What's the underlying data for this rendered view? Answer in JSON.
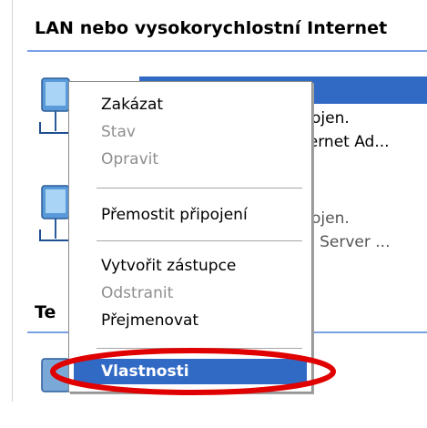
{
  "groups": {
    "lan_header": "LAN nebo vysokorychlostní Internet",
    "tel_header": "Te"
  },
  "connection1": {
    "line2": "ojen.",
    "line3": "hernet Ad..."
  },
  "connection2": {
    "line2": "ojen.",
    "line3": "ss Server ..."
  },
  "context_menu": {
    "items": [
      {
        "label": "Zakázat",
        "enabled": true
      },
      {
        "label": "Stav",
        "enabled": false
      },
      {
        "label": "Opravit",
        "enabled": false
      },
      {
        "label": "Přemostit připojení",
        "enabled": true
      },
      {
        "label": "Vytvořit zástupce",
        "enabled": true
      },
      {
        "label": "Odstranit",
        "enabled": false
      },
      {
        "label": "Přejmenovat",
        "enabled": true
      },
      {
        "label": "Vlastnosti",
        "enabled": true,
        "highlighted": true
      }
    ]
  },
  "colors": {
    "selection_blue": "#316ac5",
    "disabled_text": "#8e8e8e",
    "annotation_red": "#e00000"
  },
  "icons": {
    "connection": "network-connection-icon"
  }
}
